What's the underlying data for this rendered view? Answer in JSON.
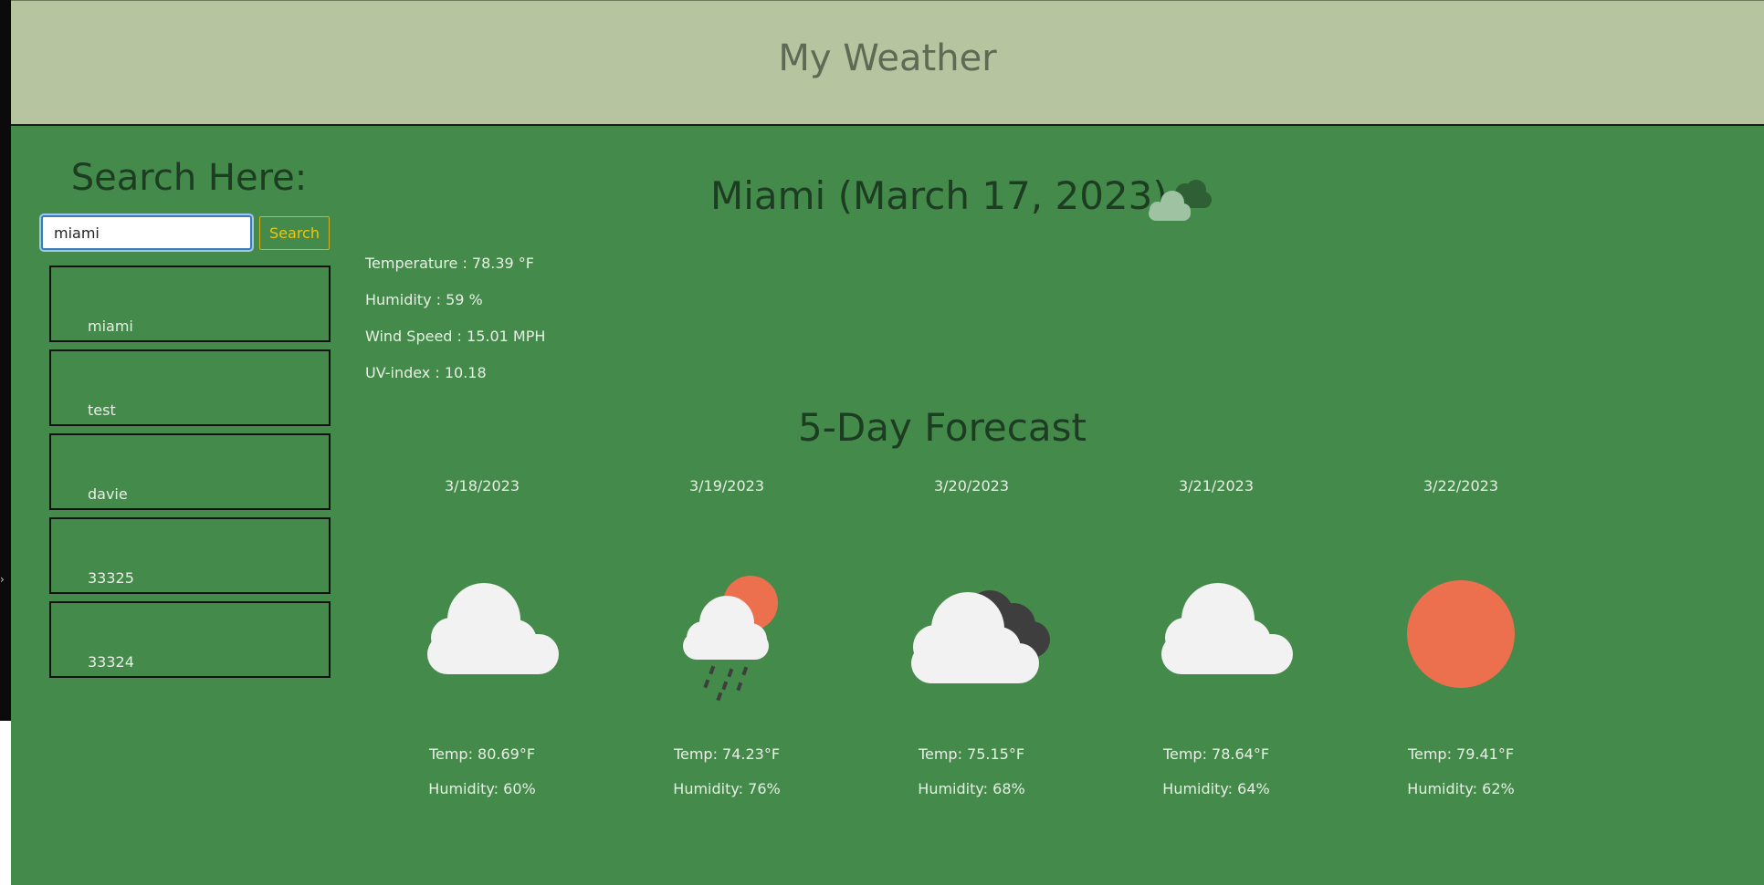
{
  "header": {
    "title": "My Weather"
  },
  "search": {
    "title": "Search Here:",
    "input_value": "miami",
    "button_label": "Search"
  },
  "history": [
    "miami",
    "test",
    "davie",
    "33325",
    "33324"
  ],
  "current": {
    "title": "Miami (March 17, 2023)",
    "icon": "broken-clouds-icon",
    "temperature": "Temperature : 78.39 °F",
    "humidity": "Humidity : 59 %",
    "wind": "Wind Speed : 15.01 MPH",
    "uv": "UV-index : 10.18"
  },
  "forecast": {
    "title": "5-Day Forecast",
    "days": [
      {
        "date": "3/18/2023",
        "icon": "cloud-icon",
        "temp": "Temp: 80.69°F",
        "humidity": "Humidity: 60%"
      },
      {
        "date": "3/19/2023",
        "icon": "rain-sun-icon",
        "temp": "Temp: 74.23°F",
        "humidity": "Humidity: 76%"
      },
      {
        "date": "3/20/2023",
        "icon": "broken-clouds-icon",
        "temp": "Temp: 75.15°F",
        "humidity": "Humidity: 68%"
      },
      {
        "date": "3/21/2023",
        "icon": "cloud-icon",
        "temp": "Temp: 78.64°F",
        "humidity": "Humidity: 64%"
      },
      {
        "date": "3/22/2023",
        "icon": "sun-icon",
        "temp": "Temp: 79.41°F",
        "humidity": "Humidity: 62%"
      }
    ]
  },
  "colors": {
    "header_bg": "#b6c4a0",
    "main_bg": "#448a4a",
    "heading_text": "#1d3d22",
    "accent_button": "#f1c40f",
    "sun": "#ec6f4e",
    "cloud_light": "#f2f2f2",
    "cloud_dark": "#3e3e3e"
  }
}
